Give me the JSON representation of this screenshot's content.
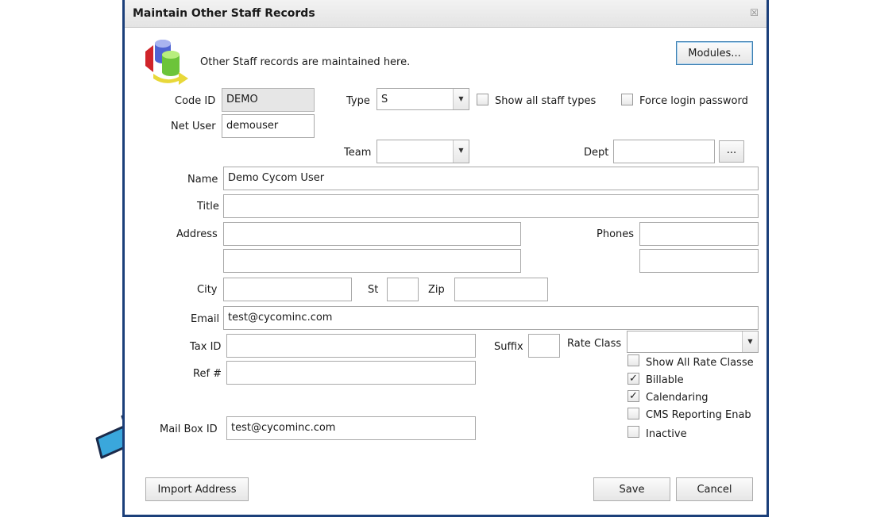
{
  "window": {
    "title": "Maintain Other Staff Records",
    "close_glyph": "☒"
  },
  "header": {
    "description": "Other Staff records are maintained here.",
    "modules_button": "Modules..."
  },
  "fields": {
    "code_id": {
      "label": "Code ID",
      "value": "DEMO"
    },
    "type": {
      "label": "Type",
      "value": "S"
    },
    "show_all_staff_types": {
      "label": "Show all staff types",
      "checked": false
    },
    "force_login_password": {
      "label": "Force login password",
      "checked": false
    },
    "net_user": {
      "label": "Net User",
      "value": "demouser"
    },
    "team": {
      "label": "Team",
      "value": ""
    },
    "dept": {
      "label": "Dept",
      "value": "",
      "browse": "..."
    },
    "name": {
      "label": "Name",
      "value": "Demo Cycom User"
    },
    "title": {
      "label": "Title",
      "value": ""
    },
    "address": {
      "label": "Address",
      "line1": "",
      "line2": ""
    },
    "phones": {
      "label": "Phones",
      "phone1": "",
      "phone2": ""
    },
    "city": {
      "label": "City",
      "value": ""
    },
    "state": {
      "label": "St",
      "value": ""
    },
    "zip": {
      "label": "Zip",
      "value": ""
    },
    "email": {
      "label": "Email",
      "value": "test@cycominc.com"
    },
    "tax_id": {
      "label": "Tax ID",
      "value": ""
    },
    "suffix": {
      "label": "Suffix",
      "value": ""
    },
    "rate_class": {
      "label": "Rate Class",
      "value": ""
    },
    "ref": {
      "label": "Ref #",
      "value": ""
    },
    "mailbox_id": {
      "label": "Mail Box ID",
      "value": "test@cycominc.com"
    }
  },
  "options": [
    {
      "label": "Show All Rate Classe",
      "checked": false
    },
    {
      "label": "Billable",
      "checked": true
    },
    {
      "label": "Calendaring",
      "checked": true
    },
    {
      "label": "CMS Reporting Enab",
      "checked": false
    },
    {
      "label": "Inactive",
      "checked": false
    }
  ],
  "check_glyph": "✓",
  "dropdown_glyph": "▼",
  "footer": {
    "import_address": "Import Address",
    "save": "Save",
    "cancel": "Cancel"
  },
  "colors": {
    "callout_arrow": "#3aa7dc",
    "callout_outline": "#1b2a4a",
    "dialog_border": "#1b3f7a"
  }
}
